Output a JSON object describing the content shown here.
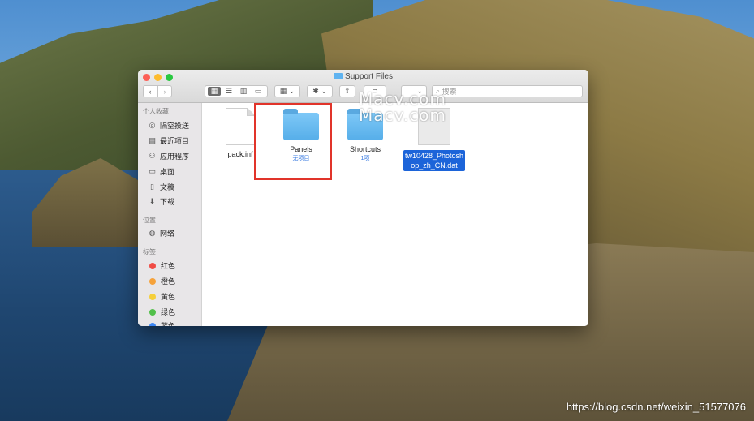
{
  "window": {
    "title": "Support Files"
  },
  "toolbar": {
    "back": "‹",
    "forward": "›",
    "views": [
      "▦",
      "☰",
      "▥",
      "▭"
    ],
    "arrange": "▦ ⌄",
    "action": "✱ ⌄",
    "share": "⇪",
    "tag": "⊃",
    "dropdown": "⌄",
    "search_placeholder": "搜索"
  },
  "sidebar": {
    "favorites_heading": "个人收藏",
    "favorites": [
      {
        "label": "隔空投送",
        "icon": "airdrop-icon"
      },
      {
        "label": "最近项目",
        "icon": "recents-icon"
      },
      {
        "label": "应用程序",
        "icon": "applications-icon"
      },
      {
        "label": "桌面",
        "icon": "desktop-icon"
      },
      {
        "label": "文稿",
        "icon": "documents-icon"
      },
      {
        "label": "下载",
        "icon": "downloads-icon"
      }
    ],
    "locations_heading": "位置",
    "locations": [
      {
        "label": "网络",
        "icon": "network-icon"
      }
    ],
    "tags_heading": "标签",
    "tags": [
      {
        "label": "红色",
        "color": "#f04b44"
      },
      {
        "label": "橙色",
        "color": "#f6a23a"
      },
      {
        "label": "黄色",
        "color": "#f5cf3a"
      },
      {
        "label": "绿色",
        "color": "#52c04a"
      },
      {
        "label": "蓝色",
        "color": "#3d87f5"
      }
    ]
  },
  "files": [
    {
      "name": "pack.inf",
      "kind": "document",
      "sub": ""
    },
    {
      "name": "Panels",
      "kind": "folder",
      "sub": "无项目"
    },
    {
      "name": "Shortcuts",
      "kind": "folder",
      "sub": "1项"
    },
    {
      "name_line1": "tw10428_Photosh",
      "name_line2": "op_zh_CN.dat",
      "kind": "document-selected"
    }
  ],
  "watermark": "Macv.com",
  "source_credit": "https://blog.csdn.net/weixin_51577076"
}
